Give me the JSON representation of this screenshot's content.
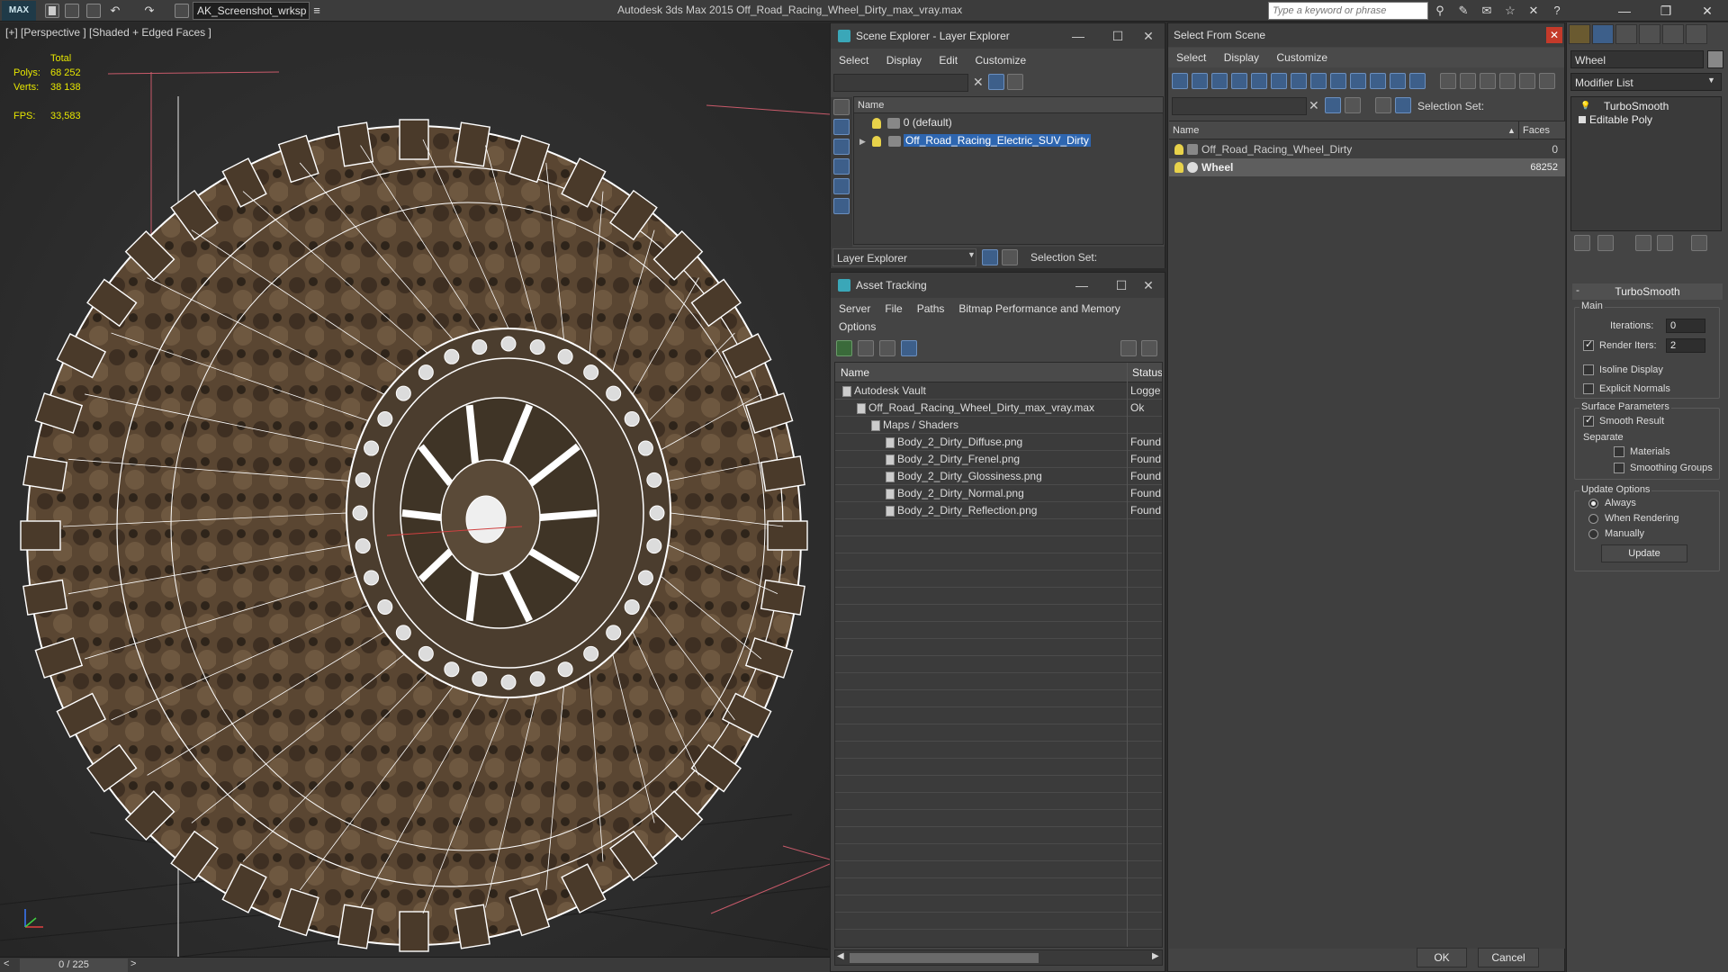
{
  "titlebar": {
    "app_logo": "MAX",
    "workspace": "AK_Screenshot_wrksp",
    "title": "Autodesk 3ds Max  2015     Off_Road_Racing_Wheel_Dirty_max_vray.max",
    "search_placeholder": "Type a keyword or phrase"
  },
  "viewport": {
    "label": "[+] [Perspective ] [Shaded + Edged Faces ]",
    "stats": {
      "total_label": "Total",
      "polys_label": "Polys:",
      "polys_value": "68 252",
      "verts_label": "Verts:",
      "verts_value": "38 138",
      "fps_label": "FPS:",
      "fps_value": "33,583"
    },
    "timeline": "0 / 225"
  },
  "scene_explorer": {
    "title": "Scene Explorer - Layer Explorer",
    "menu": [
      "Select",
      "Display",
      "Edit",
      "Customize"
    ],
    "column_name": "Name",
    "rows": [
      {
        "label": "0 (default)",
        "selected": false
      },
      {
        "label": "Off_Road_Racing_Electric_SUV_Dirty",
        "selected": true
      }
    ],
    "footer_dropdown": "Layer Explorer",
    "selection_set_label": "Selection Set:"
  },
  "asset_tracking": {
    "title": "Asset Tracking",
    "menu": [
      "Server",
      "File",
      "Paths",
      "Bitmap Performance and Memory",
      "Options"
    ],
    "columns": [
      "Name",
      "Status"
    ],
    "rows": [
      {
        "name": "Autodesk Vault",
        "status": "Logge",
        "indent": 1
      },
      {
        "name": "Off_Road_Racing_Wheel_Dirty_max_vray.max",
        "status": "Ok",
        "indent": 2
      },
      {
        "name": "Maps / Shaders",
        "status": "",
        "indent": 3
      },
      {
        "name": "Body_2_Dirty_Diffuse.png",
        "status": "Found",
        "indent": 4
      },
      {
        "name": "Body_2_Dirty_Frenel.png",
        "status": "Found",
        "indent": 4
      },
      {
        "name": "Body_2_Dirty_Glossiness.png",
        "status": "Found",
        "indent": 4
      },
      {
        "name": "Body_2_Dirty_Normal.png",
        "status": "Found",
        "indent": 4
      },
      {
        "name": "Body_2_Dirty_Reflection.png",
        "status": "Found",
        "indent": 4
      }
    ]
  },
  "select_from_scene": {
    "title": "Select From Scene",
    "menu": [
      "Select",
      "Display",
      "Customize"
    ],
    "selection_set_label": "Selection Set:",
    "columns": [
      "Name",
      "Faces"
    ],
    "rows": [
      {
        "name": "Off_Road_Racing_Wheel_Dirty",
        "faces": "0",
        "selected": false
      },
      {
        "name": "Wheel",
        "faces": "68252",
        "selected": true
      }
    ],
    "ok_label": "OK",
    "cancel_label": "Cancel"
  },
  "command_panel": {
    "object_name": "Wheel",
    "modifier_list": "Modifier List",
    "stack": [
      "TurboSmooth",
      "Editable Poly"
    ],
    "rollout_title": "TurboSmooth",
    "main_label": "Main",
    "iterations_label": "Iterations:",
    "iterations_value": "0",
    "render_iters_label": "Render Iters:",
    "render_iters_value": "2",
    "render_iters_checked": true,
    "isoline_display_label": "Isoline Display",
    "explicit_normals_label": "Explicit Normals",
    "surface_parameters_label": "Surface Parameters",
    "smooth_result_label": "Smooth Result",
    "separate_label": "Separate",
    "materials_label": "Materials",
    "smoothing_groups_label": "Smoothing Groups",
    "update_options_label": "Update Options",
    "always_label": "Always",
    "when_rendering_label": "When Rendering",
    "manually_label": "Manually",
    "update_button": "Update"
  },
  "colors": {
    "selection_blue": "#2e66b0",
    "stats_yellow": "#e6e600",
    "wire_white": "#ffffff",
    "tire_brown": "#5a4632"
  }
}
